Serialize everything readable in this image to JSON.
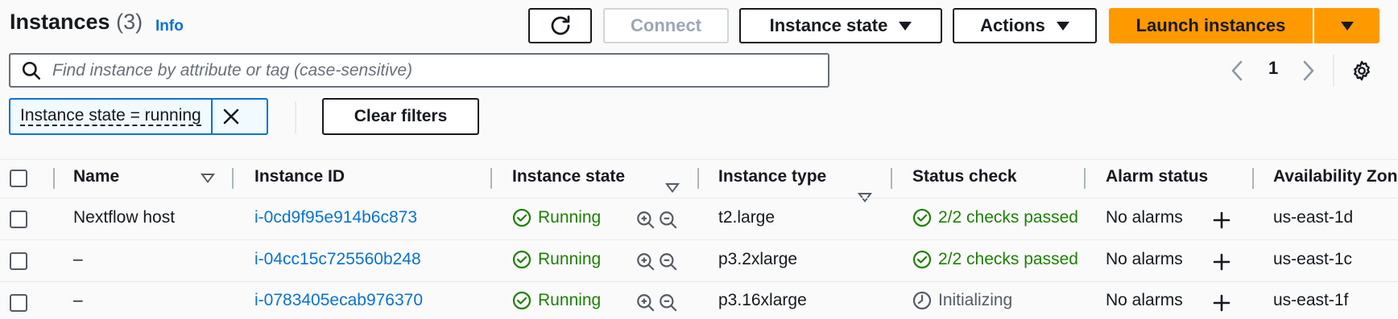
{
  "header": {
    "title": "Instances",
    "count": "(3)",
    "info": "Info"
  },
  "toolbar": {
    "connect": "Connect",
    "instance_state": "Instance state",
    "actions": "Actions",
    "launch": "Launch instances"
  },
  "search": {
    "placeholder": "Find instance by attribute or tag (case-sensitive)",
    "value": ""
  },
  "pagination": {
    "current_page": "1"
  },
  "filter": {
    "token": "Instance state = running",
    "clear": "Clear filters"
  },
  "table": {
    "columns": [
      "Name",
      "Instance ID",
      "Instance state",
      "Instance type",
      "Status check",
      "Alarm status",
      "Availability Zone"
    ],
    "rows": [
      {
        "name": "Nextflow host",
        "id": "i-0cd9f95e914b6c873",
        "state": "Running",
        "type": "t2.large",
        "status": "2/2 checks passed",
        "status_kind": "passed",
        "alarm": "No alarms",
        "az": "us-east-1d"
      },
      {
        "name": "–",
        "id": "i-04cc15c725560b248",
        "state": "Running",
        "type": "p3.2xlarge",
        "status": "2/2 checks passed",
        "status_kind": "passed",
        "alarm": "No alarms",
        "az": "us-east-1c"
      },
      {
        "name": "–",
        "id": "i-0783405ecab976370",
        "state": "Running",
        "type": "p3.16xlarge",
        "status": "Initializing",
        "status_kind": "initializing",
        "alarm": "No alarms",
        "az": "us-east-1f"
      }
    ]
  },
  "colors": {
    "primary": "#ff9900",
    "link": "#0972d3",
    "success": "#1d8102",
    "text": "#16191f"
  }
}
